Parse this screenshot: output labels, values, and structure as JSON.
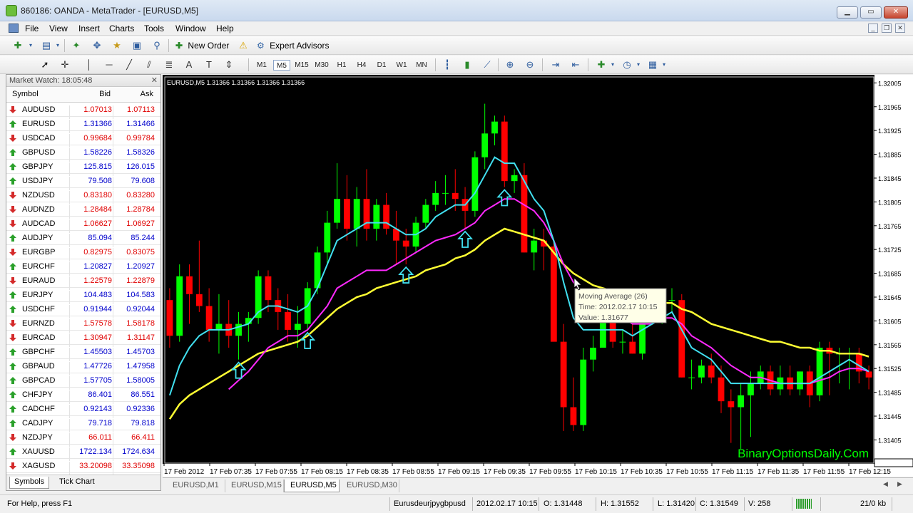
{
  "window": {
    "title": "860186: OANDA - MetaTrader - [EURUSD,M5]"
  },
  "menu": [
    "File",
    "View",
    "Insert",
    "Charts",
    "Tools",
    "Window",
    "Help"
  ],
  "toolbar1": {
    "new_order": "New Order",
    "expert_advisors": "Expert Advisors"
  },
  "timeframes": [
    "M1",
    "M5",
    "M15",
    "M30",
    "H1",
    "H4",
    "D1",
    "W1",
    "MN"
  ],
  "active_timeframe": "M5",
  "market_watch": {
    "title": "Market Watch: 18:05:48",
    "col_symbol": "Symbol",
    "col_bid": "Bid",
    "col_ask": "Ask",
    "rows": [
      {
        "symbol": "AUDUSD",
        "bid": "1.07013",
        "ask": "1.07113",
        "dir": "down"
      },
      {
        "symbol": "EURUSD",
        "bid": "1.31366",
        "ask": "1.31466",
        "dir": "up"
      },
      {
        "symbol": "USDCAD",
        "bid": "0.99684",
        "ask": "0.99784",
        "dir": "down"
      },
      {
        "symbol": "GBPUSD",
        "bid": "1.58226",
        "ask": "1.58326",
        "dir": "up"
      },
      {
        "symbol": "GBPJPY",
        "bid": "125.815",
        "ask": "126.015",
        "dir": "up"
      },
      {
        "symbol": "USDJPY",
        "bid": "79.508",
        "ask": "79.608",
        "dir": "up"
      },
      {
        "symbol": "NZDUSD",
        "bid": "0.83180",
        "ask": "0.83280",
        "dir": "down"
      },
      {
        "symbol": "AUDNZD",
        "bid": "1.28484",
        "ask": "1.28784",
        "dir": "down"
      },
      {
        "symbol": "AUDCAD",
        "bid": "1.06627",
        "ask": "1.06927",
        "dir": "down"
      },
      {
        "symbol": "AUDJPY",
        "bid": "85.094",
        "ask": "85.244",
        "dir": "up"
      },
      {
        "symbol": "EURGBP",
        "bid": "0.82975",
        "ask": "0.83075",
        "dir": "down"
      },
      {
        "symbol": "EURCHF",
        "bid": "1.20827",
        "ask": "1.20927",
        "dir": "up"
      },
      {
        "symbol": "EURAUD",
        "bid": "1.22579",
        "ask": "1.22879",
        "dir": "down"
      },
      {
        "symbol": "EURJPY",
        "bid": "104.483",
        "ask": "104.583",
        "dir": "up"
      },
      {
        "symbol": "USDCHF",
        "bid": "0.91944",
        "ask": "0.92044",
        "dir": "up"
      },
      {
        "symbol": "EURNZD",
        "bid": "1.57578",
        "ask": "1.58178",
        "dir": "down"
      },
      {
        "symbol": "EURCAD",
        "bid": "1.30947",
        "ask": "1.31147",
        "dir": "down"
      },
      {
        "symbol": "GBPCHF",
        "bid": "1.45503",
        "ask": "1.45703",
        "dir": "up"
      },
      {
        "symbol": "GBPAUD",
        "bid": "1.47726",
        "ask": "1.47958",
        "dir": "up"
      },
      {
        "symbol": "GBPCAD",
        "bid": "1.57705",
        "ask": "1.58005",
        "dir": "up"
      },
      {
        "symbol": "CHFJPY",
        "bid": "86.401",
        "ask": "86.551",
        "dir": "up"
      },
      {
        "symbol": "CADCHF",
        "bid": "0.92143",
        "ask": "0.92336",
        "dir": "up"
      },
      {
        "symbol": "CADJPY",
        "bid": "79.718",
        "ask": "79.818",
        "dir": "up"
      },
      {
        "symbol": "NZDJPY",
        "bid": "66.011",
        "ask": "66.411",
        "dir": "down"
      },
      {
        "symbol": "XAUUSD",
        "bid": "1722.134",
        "ask": "1724.634",
        "dir": "up"
      },
      {
        "symbol": "XAGUSD",
        "bid": "33.20098",
        "ask": "33.35098",
        "dir": "down"
      }
    ],
    "tabs": [
      "Symbols",
      "Tick Chart"
    ]
  },
  "chart_tabs": [
    "EURUSD,M1",
    "EURUSD,M15",
    "EURUSD,M5",
    "EURUSD,M30"
  ],
  "colors": {
    "bull": "#00ff00",
    "bear": "#ff0000",
    "ma_fast": "#41e0f0",
    "ma_mid": "#ff29ff",
    "ma_slow": "#ffff33",
    "up_price": "#0000cc",
    "down_price": "#e00000"
  },
  "status": {
    "help": "For Help, press F1",
    "profile": "Eurusdeurjpygbpusd",
    "time": "2012.02.17 10:15",
    "open": "O: 1.31448",
    "high": "H: 1.31552",
    "low": "L: 1.31420",
    "close": "C: 1.31549",
    "volume": "V: 258",
    "traffic": "21/0 kb"
  },
  "chart_data": {
    "type": "candlestick",
    "header": "EURUSD,M5  1.31366 1.31366 1.31366 1.31366",
    "watermark": "BinaryOptionsDaily.Com",
    "y_ticks": [
      "1.32005",
      "1.31965",
      "1.31925",
      "1.31885",
      "1.31845",
      "1.31805",
      "1.31765",
      "1.31725",
      "1.31685",
      "1.31645",
      "1.31605",
      "1.31565",
      "1.31525",
      "1.31485",
      "1.31445",
      "1.31405",
      "1.31366"
    ],
    "ylim": [
      1.31366,
      1.32015
    ],
    "x_ticks": [
      "17 Feb 2012",
      "17 Feb 07:35",
      "17 Feb 07:55",
      "17 Feb 08:15",
      "17 Feb 08:35",
      "17 Feb 08:55",
      "17 Feb 09:15",
      "17 Feb 09:35",
      "17 Feb 09:55",
      "17 Feb 10:15",
      "17 Feb 10:35",
      "17 Feb 10:55",
      "17 Feb 11:15",
      "17 Feb 11:35",
      "17 Feb 11:55",
      "17 Feb 12:15"
    ],
    "candles": [
      [
        1.3164,
        1.3166,
        1.3156,
        1.3158
      ],
      [
        1.3158,
        1.317,
        1.3157,
        1.3168
      ],
      [
        1.3168,
        1.317,
        1.316,
        1.3165
      ],
      [
        1.3165,
        1.3174,
        1.3162,
        1.3163
      ],
      [
        1.3163,
        1.3166,
        1.3157,
        1.3159
      ],
      [
        1.3159,
        1.3165,
        1.3155,
        1.316
      ],
      [
        1.316,
        1.3164,
        1.3156,
        1.3158
      ],
      [
        1.3158,
        1.3162,
        1.3154,
        1.316
      ],
      [
        1.316,
        1.3162,
        1.3157,
        1.3161
      ],
      [
        1.3161,
        1.3169,
        1.316,
        1.3168
      ],
      [
        1.3168,
        1.3169,
        1.3162,
        1.3164
      ],
      [
        1.3164,
        1.3166,
        1.3159,
        1.3162
      ],
      [
        1.3162,
        1.3165,
        1.3157,
        1.3159
      ],
      [
        1.3159,
        1.3163,
        1.3156,
        1.316
      ],
      [
        1.316,
        1.3167,
        1.3159,
        1.3166
      ],
      [
        1.3166,
        1.3173,
        1.3165,
        1.3172
      ],
      [
        1.3172,
        1.3179,
        1.317,
        1.3177
      ],
      [
        1.3177,
        1.3187,
        1.3176,
        1.3181
      ],
      [
        1.3181,
        1.3185,
        1.3174,
        1.3176
      ],
      [
        1.3176,
        1.3183,
        1.3173,
        1.3181
      ],
      [
        1.3181,
        1.3186,
        1.3174,
        1.3176
      ],
      [
        1.3176,
        1.3181,
        1.3174,
        1.318
      ],
      [
        1.318,
        1.3182,
        1.3175,
        1.3176
      ],
      [
        1.3176,
        1.3179,
        1.317,
        1.3174
      ],
      [
        1.3174,
        1.3176,
        1.317,
        1.3173
      ],
      [
        1.3173,
        1.3178,
        1.3172,
        1.3177
      ],
      [
        1.3177,
        1.3181,
        1.3176,
        1.318
      ],
      [
        1.318,
        1.3184,
        1.3179,
        1.3182
      ],
      [
        1.3182,
        1.3185,
        1.318,
        1.3182
      ],
      [
        1.3182,
        1.3186,
        1.3179,
        1.3181
      ],
      [
        1.3181,
        1.3183,
        1.3176,
        1.3179
      ],
      [
        1.3179,
        1.3189,
        1.3178,
        1.3188
      ],
      [
        1.3188,
        1.3197,
        1.3186,
        1.3192
      ],
      [
        1.3192,
        1.3195,
        1.319,
        1.3194
      ],
      [
        1.3194,
        1.3195,
        1.3183,
        1.3184
      ],
      [
        1.3184,
        1.3186,
        1.3182,
        1.3185
      ],
      [
        1.3185,
        1.3187,
        1.3172,
        1.3172
      ],
      [
        1.3172,
        1.3176,
        1.3169,
        1.3174
      ],
      [
        1.3174,
        1.3176,
        1.3169,
        1.3173
      ],
      [
        1.3173,
        1.3174,
        1.316,
        1.3157
      ],
      [
        1.3157,
        1.316,
        1.3142,
        1.3146
      ],
      [
        1.3146,
        1.3151,
        1.3142,
        1.3143
      ],
      [
        1.3143,
        1.3156,
        1.3142,
        1.3154
      ],
      [
        1.3154,
        1.3158,
        1.3152,
        1.3156
      ],
      [
        1.3156,
        1.3163,
        1.3156,
        1.3162
      ],
      [
        1.3162,
        1.3163,
        1.3156,
        1.3157
      ],
      [
        1.3157,
        1.3159,
        1.3155,
        1.3157
      ],
      [
        1.3157,
        1.316,
        1.3155,
        1.3155
      ],
      [
        1.3155,
        1.3164,
        1.3154,
        1.3163
      ],
      [
        1.3163,
        1.3164,
        1.316,
        1.3162
      ],
      [
        1.3162,
        1.3165,
        1.316,
        1.3164
      ],
      [
        1.3164,
        1.3166,
        1.3162,
        1.3164
      ],
      [
        1.3164,
        1.3165,
        1.3151,
        1.3151
      ],
      [
        1.3151,
        1.3154,
        1.3149,
        1.3151
      ],
      [
        1.3151,
        1.3154,
        1.315,
        1.3153
      ],
      [
        1.3153,
        1.3155,
        1.315,
        1.3151
      ],
      [
        1.3151,
        1.3153,
        1.3145,
        1.3147
      ],
      [
        1.3147,
        1.3149,
        1.314,
        1.3146
      ],
      [
        1.3146,
        1.315,
        1.3139,
        1.3148
      ],
      [
        1.3148,
        1.3152,
        1.3141,
        1.315
      ],
      [
        1.315,
        1.3153,
        1.3149,
        1.3152
      ],
      [
        1.3152,
        1.3153,
        1.3148,
        1.3149
      ],
      [
        1.3149,
        1.3153,
        1.3148,
        1.3151
      ],
      [
        1.3151,
        1.3153,
        1.3148,
        1.3149
      ],
      [
        1.3149,
        1.3152,
        1.3148,
        1.3152
      ],
      [
        1.3152,
        1.3153,
        1.3146,
        1.3148
      ],
      [
        1.3148,
        1.3157,
        1.3147,
        1.3156
      ],
      [
        1.3156,
        1.3157,
        1.3148,
        1.3155
      ],
      [
        1.3155,
        1.3156,
        1.315,
        1.3155
      ],
      [
        1.3155,
        1.3156,
        1.3149,
        1.3155
      ],
      [
        1.3155,
        1.3156,
        1.315,
        1.3152
      ],
      [
        1.3152,
        1.3153,
        1.3149,
        1.3151
      ]
    ],
    "ma_fast": [
      1.3148,
      1.3153,
      1.3156,
      1.3158,
      1.3159,
      1.3159,
      1.3159,
      1.31595,
      1.316,
      1.3162,
      1.3163,
      1.3163,
      1.31625,
      1.3162,
      1.3163,
      1.3166,
      1.317,
      1.3174,
      1.3175,
      1.3176,
      1.3177,
      1.3177,
      1.3177,
      1.3176,
      1.3175,
      1.3175,
      1.3176,
      1.3178,
      1.3179,
      1.318,
      1.318,
      1.3182,
      1.3185,
      1.3188,
      1.3187,
      1.3187,
      1.3184,
      1.3181,
      1.3179,
      1.3174,
      1.3167,
      1.3161,
      1.3159,
      1.3159,
      1.3159,
      1.3159,
      1.3159,
      1.3158,
      1.3159,
      1.316,
      1.3161,
      1.3162,
      1.3159,
      1.3156,
      1.3155,
      1.3154,
      1.3152,
      1.315,
      1.315,
      1.315,
      1.315,
      1.315,
      1.315,
      1.315,
      1.315,
      1.315,
      1.3151,
      1.3152,
      1.3153,
      1.3154,
      1.3153,
      1.3152
    ],
    "ma_mid": [
      null,
      null,
      null,
      null,
      null,
      null,
      1.3149,
      1.31505,
      1.3152,
      1.3154,
      1.3156,
      1.3157,
      1.3158,
      1.3158,
      1.3159,
      1.3161,
      1.3163,
      1.3166,
      1.3167,
      1.3168,
      1.3169,
      1.3169,
      1.3169,
      1.317,
      1.3171,
      1.3172,
      1.3173,
      1.3174,
      1.31745,
      1.3175,
      1.3176,
      1.3177,
      1.3179,
      1.318,
      1.3181,
      1.3181,
      1.318,
      1.3179,
      1.3177,
      1.3174,
      1.317,
      1.3167,
      1.3165,
      1.3164,
      1.3163,
      1.3162,
      1.3161,
      1.316,
      1.316,
      1.316,
      1.3161,
      1.3161,
      1.316,
      1.3158,
      1.3157,
      1.3156,
      1.31545,
      1.3153,
      1.3152,
      1.3151,
      1.3151,
      1.31505,
      1.315,
      1.315,
      1.315,
      1.315,
      1.31505,
      1.3151,
      1.3152,
      1.31525,
      1.31525,
      1.3152
    ],
    "ma_slow": [
      1.3144,
      1.31465,
      1.3148,
      1.3149,
      1.315,
      1.3151,
      1.3152,
      1.3153,
      1.3154,
      1.3155,
      1.31555,
      1.3156,
      1.31565,
      1.3157,
      1.3158,
      1.31595,
      1.3161,
      1.31625,
      1.31635,
      1.31645,
      1.3165,
      1.3166,
      1.31665,
      1.3167,
      1.31675,
      1.3168,
      1.3169,
      1.31695,
      1.317,
      1.3171,
      1.31715,
      1.31725,
      1.3174,
      1.3175,
      1.3176,
      1.31755,
      1.3175,
      1.31745,
      1.3174,
      1.3172,
      1.317,
      1.31685,
      1.31675,
      1.31665,
      1.3166,
      1.31655,
      1.3165,
      1.31645,
      1.3164,
      1.31635,
      1.31635,
      1.31635,
      1.31625,
      1.3162,
      1.3161,
      1.316,
      1.31595,
      1.3159,
      1.31585,
      1.3158,
      1.31575,
      1.3157,
      1.3157,
      1.31565,
      1.3156,
      1.3156,
      1.31555,
      1.31555,
      1.3155,
      1.3155,
      1.3155,
      1.31545
    ],
    "signal_arrows": [
      7,
      14,
      24,
      30,
      34
    ],
    "tooltip": {
      "line1": "Moving Average (26)",
      "line2": "Time: 2012.02.17 10:15",
      "line3": "Value: 1.31677"
    }
  }
}
